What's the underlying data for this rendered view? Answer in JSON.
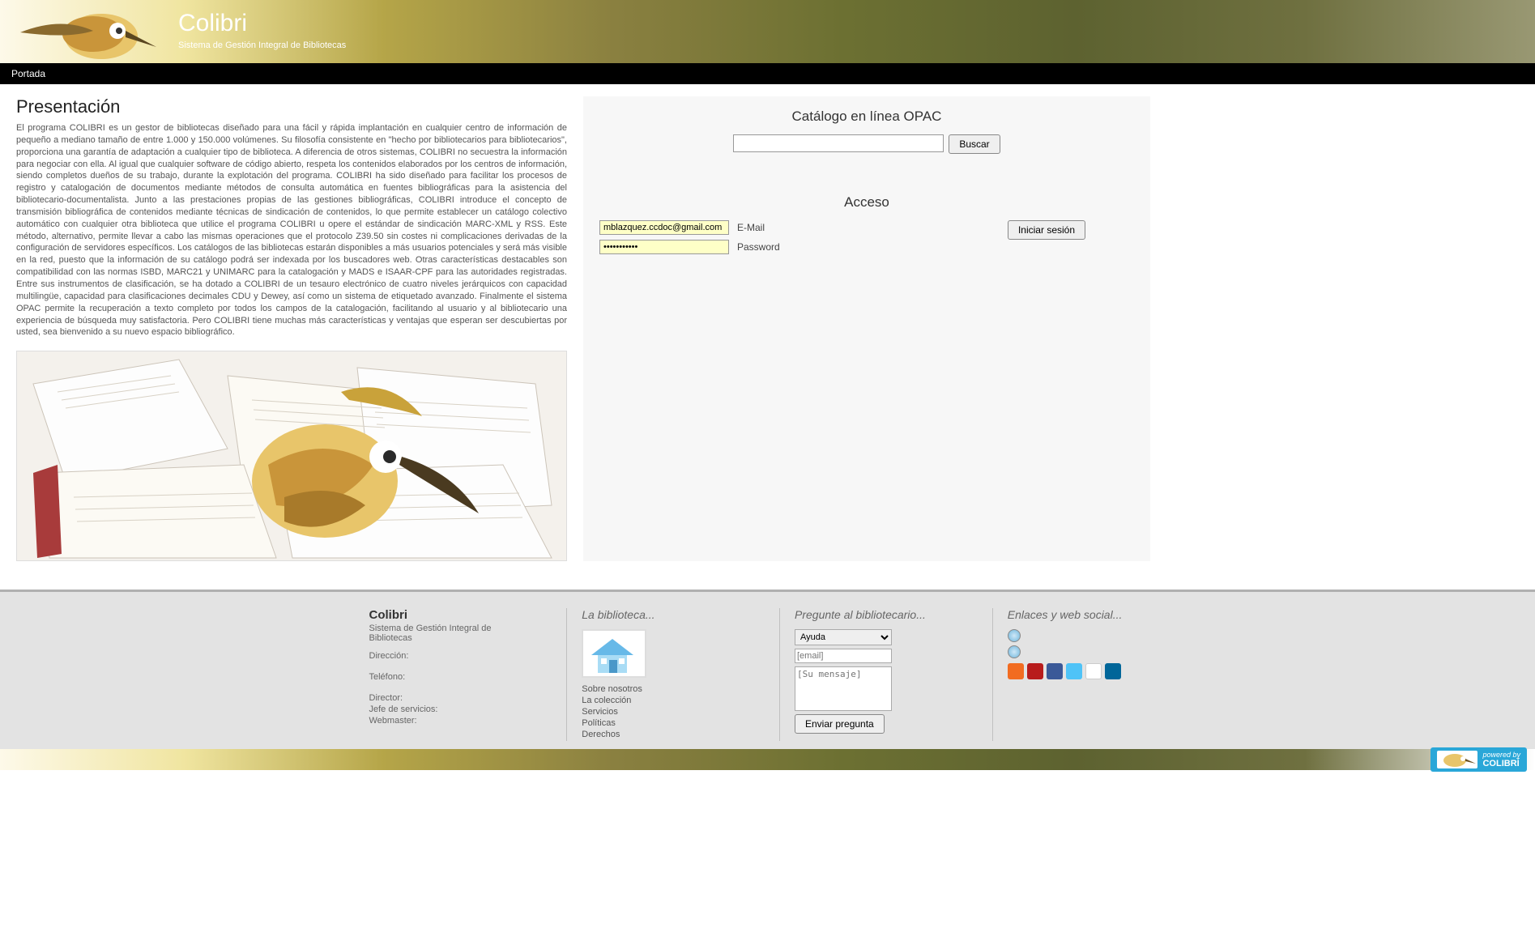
{
  "header": {
    "title": "Colibri",
    "subtitle": "Sistema de Gestión Integral de Bibliotecas"
  },
  "nav": {
    "item0": "Portada"
  },
  "presentation": {
    "heading": "Presentación",
    "body": "El programa COLIBRI es un gestor de bibliotecas diseñado para una fácil y rápida implantación en cualquier centro de información de pequeño a mediano tamaño de entre 1.000 y 150.000 volúmenes. Su filosofía consistente en \"hecho por bibliotecarios para bibliotecarios\", proporciona una garantía de adaptación a cualquier tipo de biblioteca. A diferencia de otros sistemas, COLIBRI no secuestra la información para negociar con ella. Al igual que cualquier software de código abierto, respeta los contenidos elaborados por los centros de información, siendo completos dueños de su trabajo, durante la explotación del programa. COLIBRI ha sido diseñado para facilitar los procesos de registro y catalogación de documentos mediante  métodos de consulta automática en fuentes bibliográficas para la asistencia del bibliotecario-documentalista. Junto a las prestaciones propias de las gestiones bibliográficas, COLIBRI introduce el concepto de transmisión bibliográfica de contenidos mediante técnicas de sindicación de contenidos, lo que permite establecer un catálogo colectivo automático con cualquier otra biblioteca que utilice el programa COLIBRI u opere el estándar de sindicación MARC-XML y RSS. Este método, alternativo, permite llevar a cabo las mismas operaciones que el protocolo Z39.50 sin costes ni complicaciones derivadas de la configuración de servidores específicos. Los catálogos de las bibliotecas estarán disponibles a más usuarios potenciales y será más visible en la red, puesto que la información de su catálogo podrá ser indexada por los buscadores web. Otras características destacables son compatibilidad con las normas ISBD, MARC21 y UNIMARC para la catalogación y MADS e ISAAR-CPF para las autoridades registradas. Entre sus instrumentos de clasificación, se ha dotado a COLIBRI de un tesauro electrónico de cuatro niveles jerárquicos con capacidad multilingüe, capacidad para clasificaciones decimales CDU y Dewey, así como un sistema de etiquetado avanzado. Finalmente el sistema OPAC permite la recuperación a texto completo por todos los campos de la catalogación, facilitando al usuario y al bibliotecario una experiencia de búsqueda muy satisfactoria. Pero COLIBRI tiene muchas más características y ventajas que esperan ser descubiertas por usted, sea bienvenido a su nuevo espacio bibliográfico."
  },
  "opac": {
    "heading": "Catálogo en línea OPAC",
    "search_value": "",
    "search_button": "Buscar"
  },
  "access": {
    "heading": "Acceso",
    "email_value": "mblazquez.ccdoc@gmail.com",
    "email_label": "E-Mail",
    "password_value": "•••••••••••",
    "password_label": "Password",
    "login_button": "Iniciar sesión"
  },
  "footer": {
    "col1": {
      "title": "Colibri",
      "subtitle": "Sistema de Gestión Integral de Bibliotecas",
      "direccion_lbl": "Dirección:",
      "telefono_lbl": "Teléfono:",
      "director_lbl": "Director:",
      "jefe_lbl": "Jefe de servicios:",
      "webmaster_lbl": "Webmaster:"
    },
    "col2": {
      "heading": "La biblioteca...",
      "links": [
        "Sobre nosotros",
        "La colección",
        "Servicios",
        "Políticas",
        "Derechos"
      ]
    },
    "col3": {
      "heading": "Pregunte al bibliotecario...",
      "select_value": "Ayuda",
      "email_placeholder": "[email]",
      "message_placeholder": "[Su mensaje]",
      "send_button": "Enviar pregunta"
    },
    "col4": {
      "heading": "Enlaces y web social..."
    }
  },
  "powered": {
    "text": "powered by",
    "brand": "COLIBRÍ"
  },
  "social_colors": {
    "blogger": "#f26c21",
    "youtube": "#b81c1c",
    "facebook": "#3b5998",
    "twitter": "#4fc3f7",
    "flickr": "#ffffff",
    "linkedin": "#006699"
  }
}
